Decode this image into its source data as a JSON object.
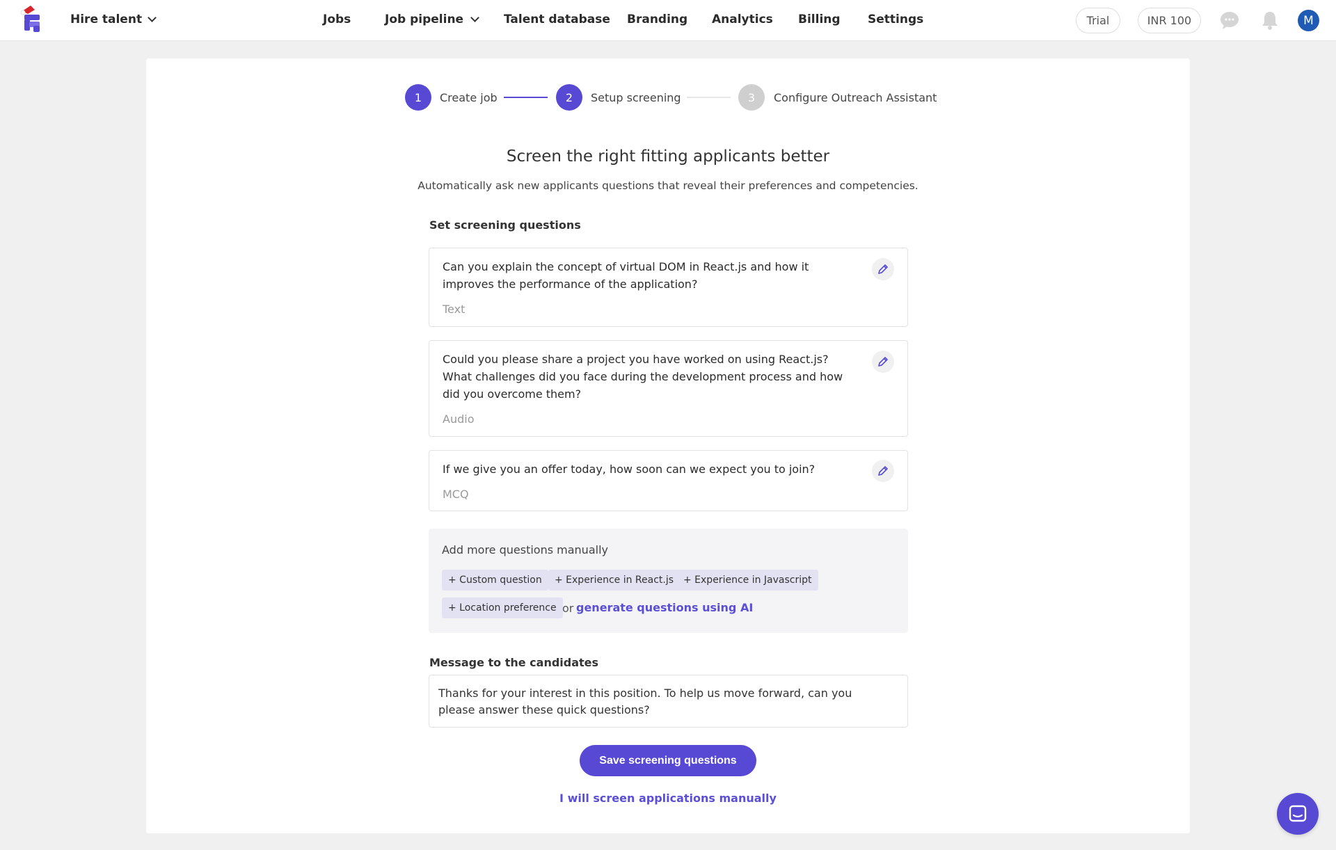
{
  "header": {
    "hire_label": "Hire talent",
    "nav": [
      {
        "label": "Jobs"
      },
      {
        "label": "Job pipeline"
      },
      {
        "label": "Talent database"
      },
      {
        "label": "Branding"
      },
      {
        "label": "Analytics"
      },
      {
        "label": "Billing"
      },
      {
        "label": "Settings"
      }
    ],
    "trial_label": "Trial",
    "credits_label": "INR 100",
    "avatar_initial": "M",
    "icons": [
      "logo-icon",
      "chevron-down-icon",
      "chat-bubble-icon",
      "bell-icon"
    ]
  },
  "stepper": {
    "steps": [
      {
        "number": "1",
        "label": "Create job",
        "state": "complete"
      },
      {
        "number": "2",
        "label": "Setup screening",
        "state": "active"
      },
      {
        "number": "3",
        "label": "Configure Outreach Assistant",
        "state": "inactive"
      }
    ]
  },
  "main": {
    "title": "Screen the right fitting applicants better",
    "subtitle": "Automatically ask new applicants questions that reveal their preferences and competencies.",
    "questions_heading": "Set screening questions",
    "questions": [
      {
        "text": "Can you explain the concept of virtual DOM in React.js and how it improves the performance of the application?",
        "type": "Text"
      },
      {
        "text": "Could you please share a project you have worked on using React.js? What challenges did you face during the development process and how did you overcome them?",
        "type": "Audio"
      },
      {
        "text": "If we give you an offer today, how soon can we expect you to join?",
        "type": "MCQ"
      }
    ],
    "add_more": {
      "title": "Add more questions manually",
      "chips": [
        "+ Custom question",
        "+ Experience in React.js",
        "+ Experience in Javascript",
        "+ Location preference"
      ],
      "or_text": "or",
      "ai_link": "generate questions using AI"
    },
    "message": {
      "heading": "Message to the candidates",
      "value": "Thanks for your interest in this position. To help us move forward, can you please answer these quick questions?"
    },
    "save_button": "Save screening questions",
    "manual_link": "I will screen applications manually"
  },
  "colors": {
    "accent": "#5749d4",
    "step_inactive": "#cfcfcf",
    "avatar": "#1f5bb5",
    "page_background": "#f0f0f0"
  }
}
